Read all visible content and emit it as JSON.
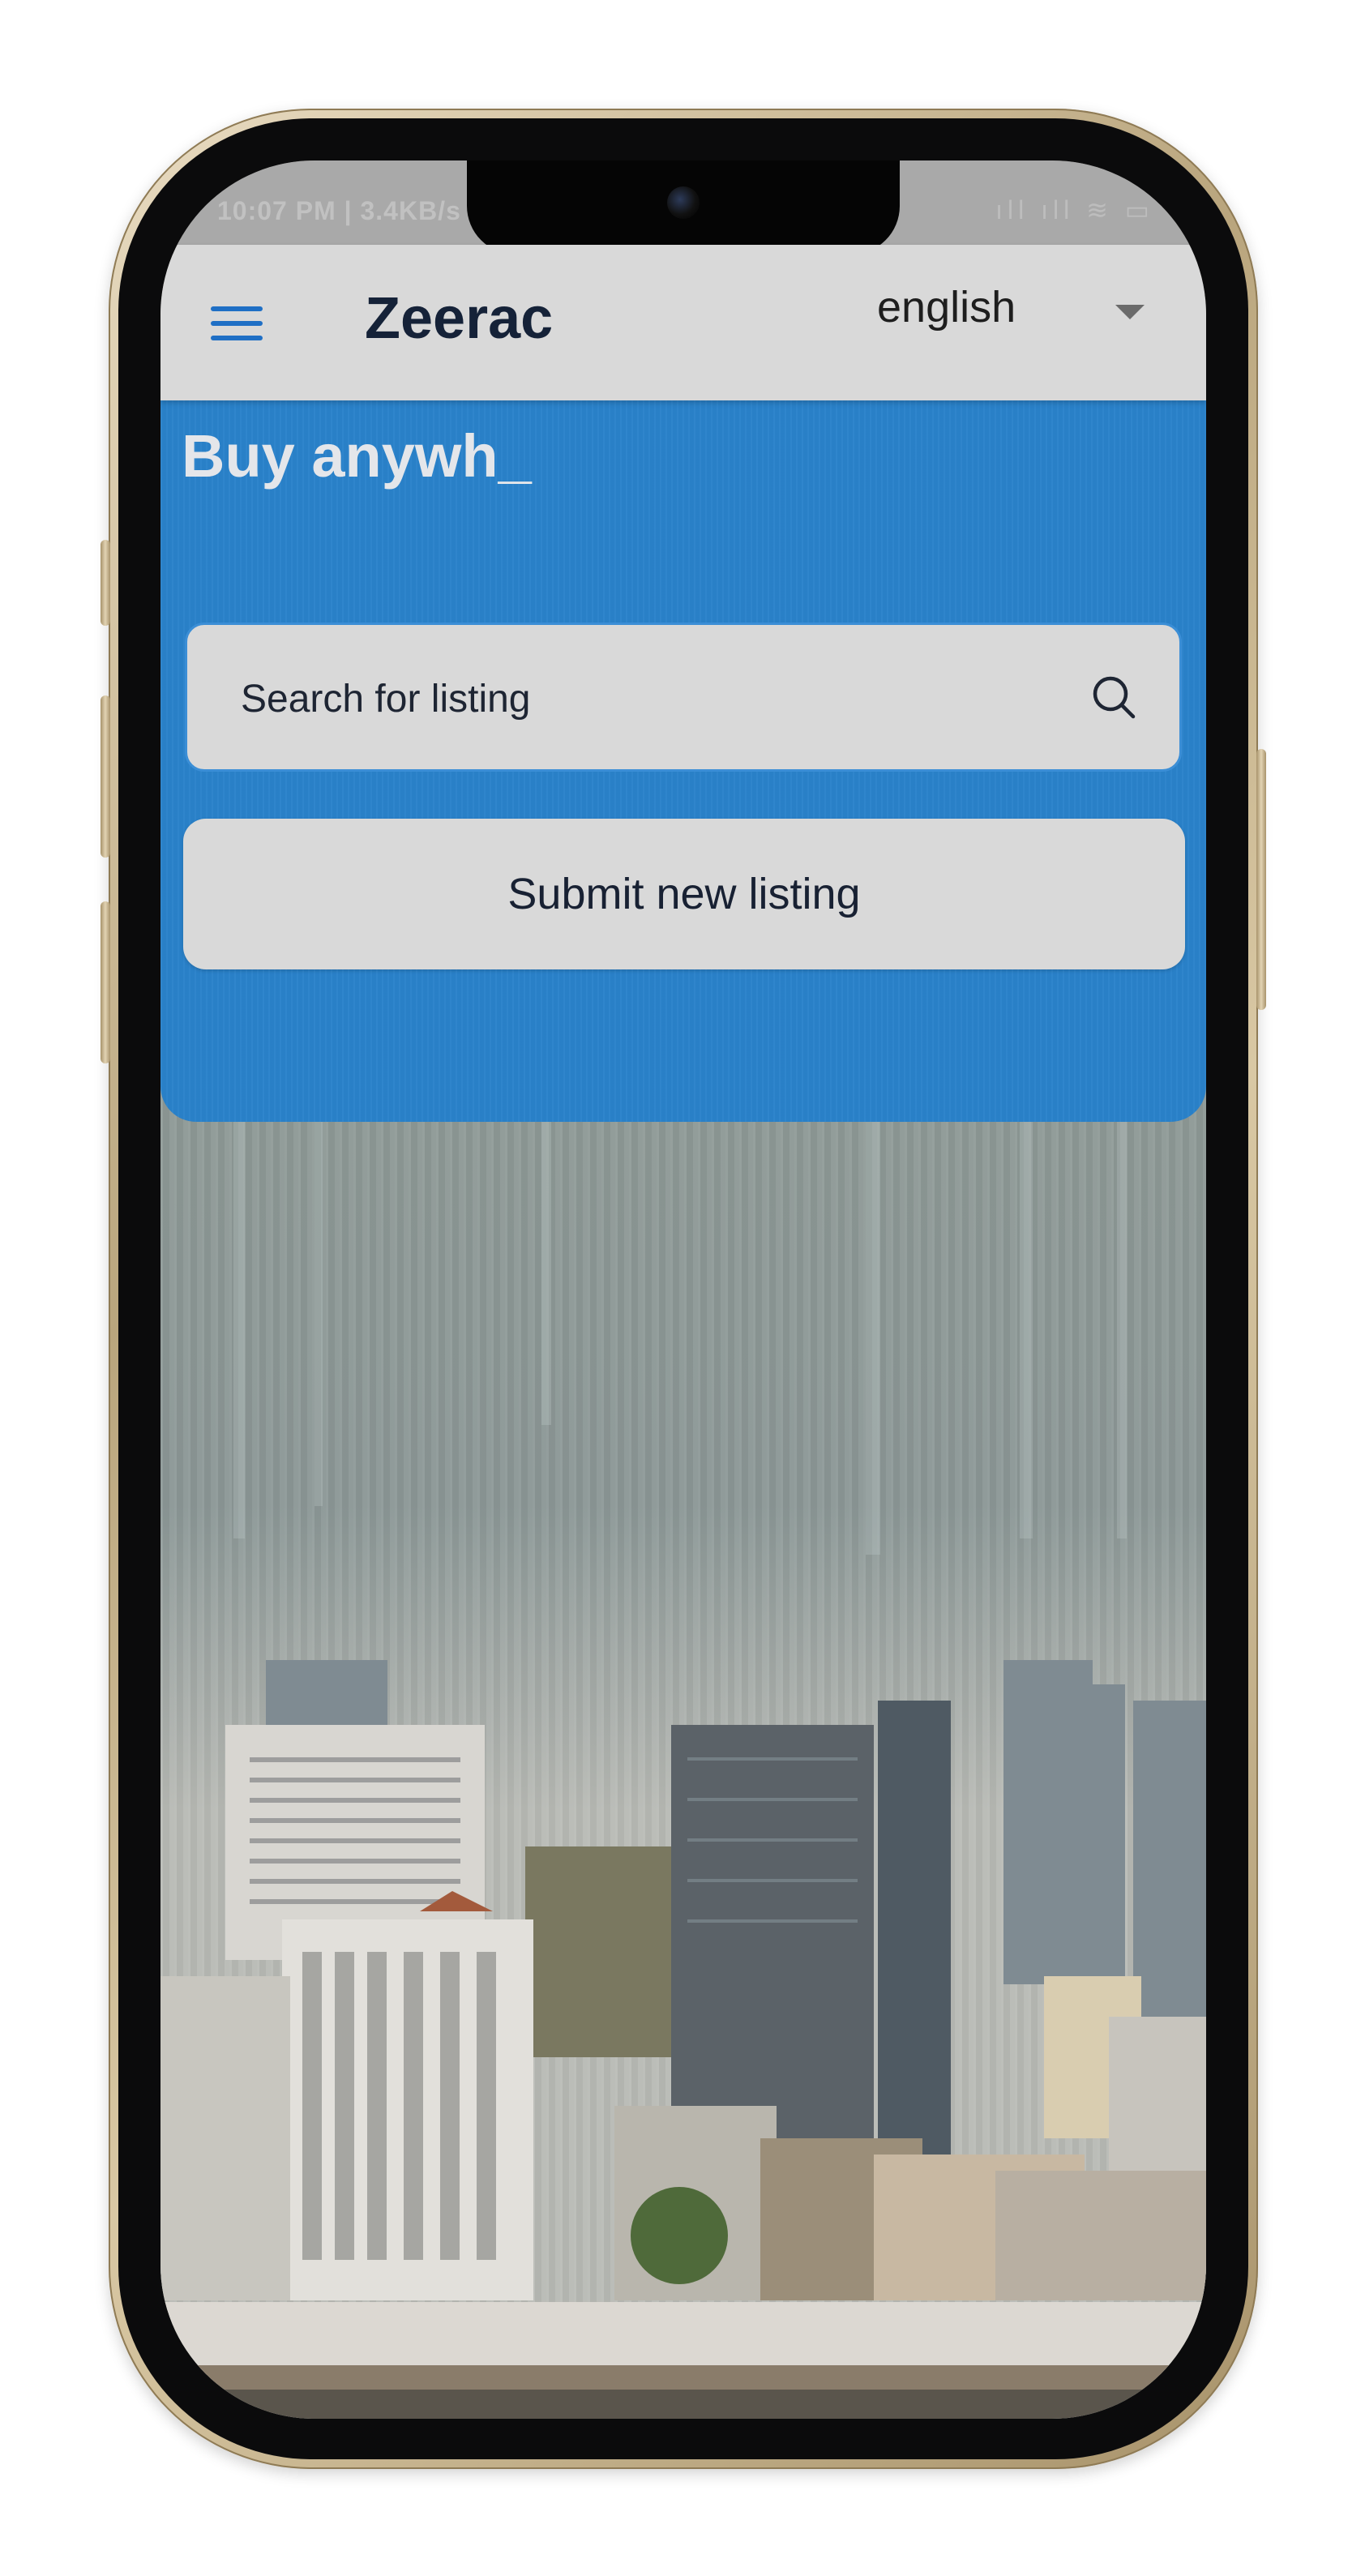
{
  "status_bar": {
    "time": "10:07 PM | 3.4KB/s",
    "icons": "ıll ıll ≋ ▭"
  },
  "header": {
    "brand": "Zeerac",
    "language": {
      "selected": "english"
    }
  },
  "hero": {
    "heading": "Buy anywh_",
    "search": {
      "placeholder": "Search for listing",
      "value": ""
    },
    "submit_label": "Submit new listing"
  },
  "colors": {
    "accent_blue": "#2a82cb",
    "header_bg": "#d9d9d9",
    "menu_icon": "#1f6fc5",
    "brand_text": "#152238"
  },
  "icons": {
    "menu": "hamburger-menu-icon",
    "dropdown": "chevron-down-icon",
    "search": "search-icon"
  }
}
